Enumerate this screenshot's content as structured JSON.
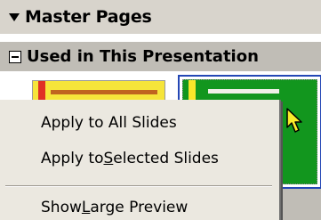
{
  "panel": {
    "master_pages_label": "Master Pages",
    "used_section_label": "Used in This Presentation"
  },
  "thumbnails": [
    {
      "name": "yellow-master",
      "color": "#f6e53a",
      "selected": false
    },
    {
      "name": "green-master",
      "color": "#12961e",
      "selected": true
    }
  ],
  "context_menu": {
    "items": [
      {
        "label": "Apply to All Slides"
      },
      {
        "label_before": "Apply to ",
        "label_mnemonic": "S",
        "label_after": "elected Slides"
      },
      {
        "label_before": "Show ",
        "label_mnemonic": "L",
        "label_after": "arge Preview"
      }
    ]
  },
  "colors": {
    "header_bg": "#d8d4cc",
    "section_bg": "#c0bdb6",
    "menu_bg": "#ebe8e0",
    "selection_border": "#2447b5"
  }
}
